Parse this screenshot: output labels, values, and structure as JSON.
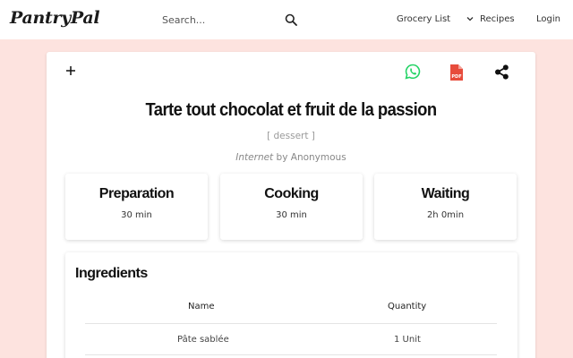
{
  "app": {
    "logo": "PantryPal"
  },
  "nav": {
    "search_placeholder": "Search...",
    "grocery_list": "Grocery List",
    "recipes": "Recipes",
    "login": "Login"
  },
  "recipe": {
    "title": "Tarte tout chocolat et fruit de la passion",
    "category": "[ dessert ]",
    "source": "Internet",
    "by": "by",
    "author": "Anonymous",
    "times": [
      {
        "label": "Preparation",
        "value": "30 min"
      },
      {
        "label": "Cooking",
        "value": "30 min"
      },
      {
        "label": "Waiting",
        "value": "2h 0min"
      }
    ],
    "ingredients": {
      "title": "Ingredients",
      "headers": {
        "name": "Name",
        "quantity": "Quantity"
      },
      "rows": [
        {
          "name": "Pâte sablée",
          "quantity": "1 Unit"
        }
      ]
    }
  },
  "colors": {
    "background": "#fde3df",
    "whatsapp": "#25d366",
    "pdf": "#e74c3c"
  },
  "icons": [
    "search-icon",
    "chevron-down-icon",
    "plus-icon",
    "whatsapp-icon",
    "pdf-icon",
    "share-icon"
  ]
}
